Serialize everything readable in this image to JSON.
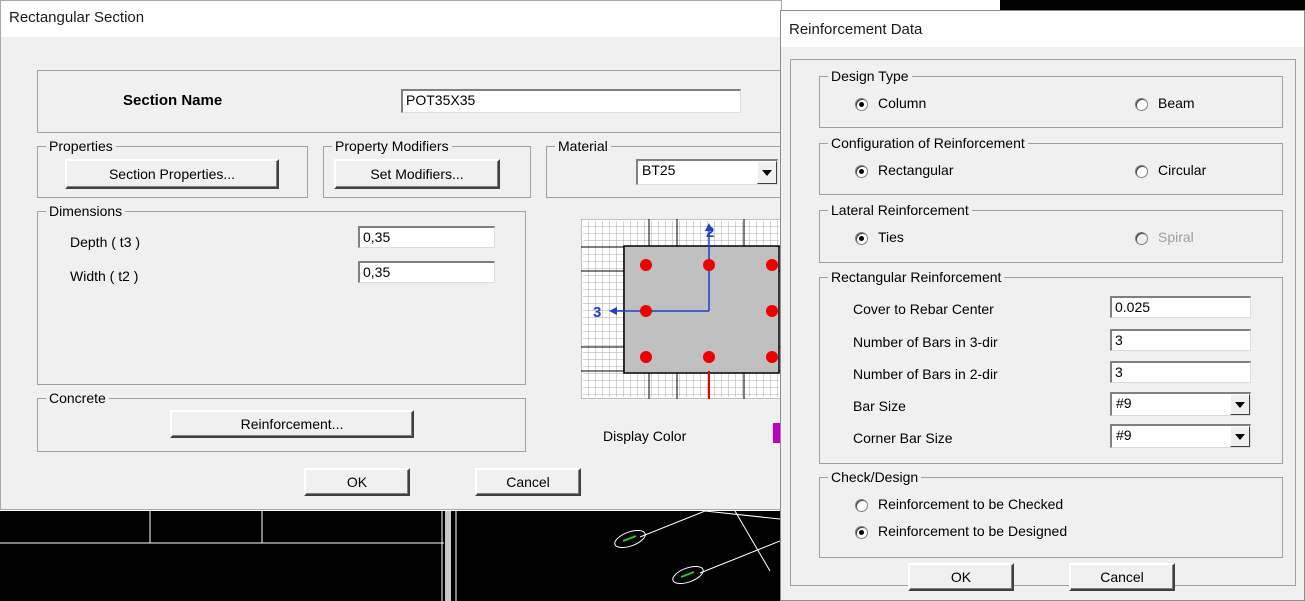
{
  "rect_section": {
    "title": "Rectangular Section",
    "section_name_label": "Section Name",
    "section_name_value": "POT35X35",
    "properties": {
      "title": "Properties",
      "button": "Section Properties..."
    },
    "property_modifiers": {
      "title": "Property Modifiers",
      "button": "Set Modifiers..."
    },
    "material": {
      "title": "Material",
      "value": "BT25"
    },
    "dimensions": {
      "title": "Dimensions",
      "depth_label": "Depth ( t3 )",
      "depth_value": "0,35",
      "width_label": "Width ( t2 )",
      "width_value": "0,35"
    },
    "concrete": {
      "title": "Concrete",
      "button": "Reinforcement..."
    },
    "display_color_label": "Display Color",
    "display_color": "#c000c0",
    "preview": {
      "axis_2": "2",
      "axis_3": "3",
      "bar_color": "#ee0000",
      "section_fill": "#c0c0c0"
    },
    "ok": "OK",
    "cancel": "Cancel"
  },
  "reinforcement_data": {
    "title": "Reinforcement Data",
    "design_type": {
      "title": "Design Type",
      "opt1": "Column",
      "opt2": "Beam",
      "selected": "Column"
    },
    "configuration": {
      "title": "Configuration of Reinforcement",
      "opt1": "Rectangular",
      "opt2": "Circular",
      "selected": "Rectangular"
    },
    "lateral": {
      "title": "Lateral Reinforcement",
      "opt1": "Ties",
      "opt2": "Spiral",
      "selected": "Ties"
    },
    "rectangular": {
      "title": "Rectangular Reinforcement",
      "cover_label": "Cover to Rebar Center",
      "cover_value": "0.025",
      "bars3_label": "Number of Bars in 3-dir",
      "bars3_value": "3",
      "bars2_label": "Number of Bars in 2-dir",
      "bars2_value": "3",
      "bar_size_label": "Bar Size",
      "bar_size_value": "#9",
      "corner_label": "Corner Bar Size",
      "corner_value": "#9"
    },
    "check_design": {
      "title": "Check/Design",
      "opt1": "Reinforcement to be Checked",
      "opt2": "Reinforcement to be Designed",
      "selected": "Reinforcement to be Designed"
    },
    "ok": "OK",
    "cancel": "Cancel"
  }
}
